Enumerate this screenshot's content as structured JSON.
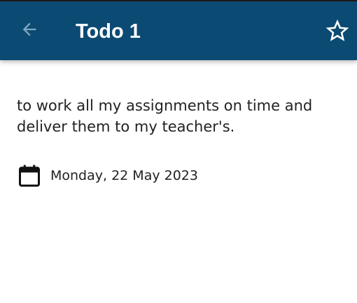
{
  "appbar": {
    "title": "Todo 1",
    "background_color": "#0b4a72",
    "back_icon": "arrow-left-icon",
    "action_icon": "star-outline-icon"
  },
  "todo": {
    "description": "to work all my assignments on time and deliver them to my teacher's.",
    "date_icon": "calendar-icon",
    "date": "Monday, 22 May 2023"
  }
}
